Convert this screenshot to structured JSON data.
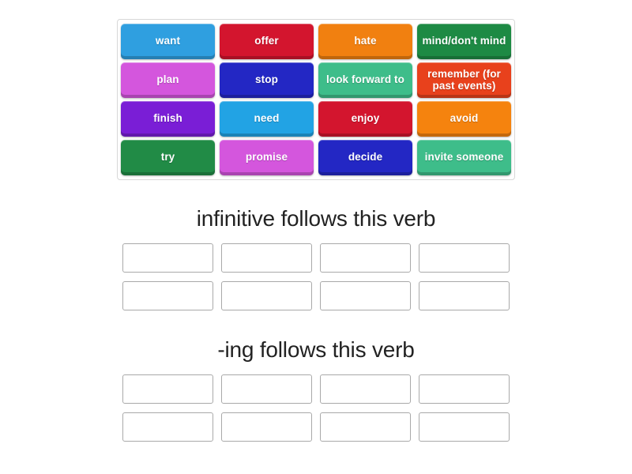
{
  "activity": {
    "type": "group-sort",
    "tile_bank": {
      "name": "verb-tile-bank",
      "columns": 4,
      "rows": 4,
      "tiles": [
        {
          "label": "want",
          "color": "#2f9fe0",
          "id": "tile-want"
        },
        {
          "label": "offer",
          "color": "#d3152e",
          "id": "tile-offer"
        },
        {
          "label": "hate",
          "color": "#f18010",
          "id": "tile-hate"
        },
        {
          "label": "mind/don't mind",
          "color": "#1d8a44",
          "id": "tile-mind-dont-mind"
        },
        {
          "label": "plan",
          "color": "#d456dd",
          "id": "tile-plan"
        },
        {
          "label": "stop",
          "color": "#2327c4",
          "id": "tile-stop"
        },
        {
          "label": "look forward to",
          "color": "#3ebd8a",
          "id": "tile-look-forward-to"
        },
        {
          "label": "remember (for past events)",
          "color": "#e8411c",
          "id": "tile-remember-past-events"
        },
        {
          "label": "finish",
          "color": "#7a1ed6",
          "id": "tile-finish"
        },
        {
          "label": "need",
          "color": "#22a3e4",
          "id": "tile-need"
        },
        {
          "label": "enjoy",
          "color": "#d3152e",
          "id": "tile-enjoy"
        },
        {
          "label": "avoid",
          "color": "#f5830e",
          "id": "tile-avoid"
        },
        {
          "label": "try",
          "color": "#218b46",
          "id": "tile-try"
        },
        {
          "label": "promise",
          "color": "#d456dd",
          "id": "tile-promise"
        },
        {
          "label": "decide",
          "color": "#2327c4",
          "id": "tile-decide"
        },
        {
          "label": "invite someone",
          "color": "#3ebd8a",
          "id": "tile-invite-someone"
        }
      ]
    },
    "groups": [
      {
        "id": "group-infinitive",
        "heading": "infinitive follows this verb",
        "slots": [
          "",
          "",
          "",
          "",
          "",
          "",
          "",
          ""
        ]
      },
      {
        "id": "group-ing",
        "heading": "-ing follows this verb",
        "slots": [
          "",
          "",
          "",
          "",
          "",
          "",
          "",
          ""
        ]
      }
    ],
    "theme": {
      "panel_border": "#d8d8d8",
      "dropzone_border": "#a9a9a9",
      "page_background": "#ffffff",
      "heading_color": "#222222",
      "tile_text_color": "#ffffff"
    }
  }
}
